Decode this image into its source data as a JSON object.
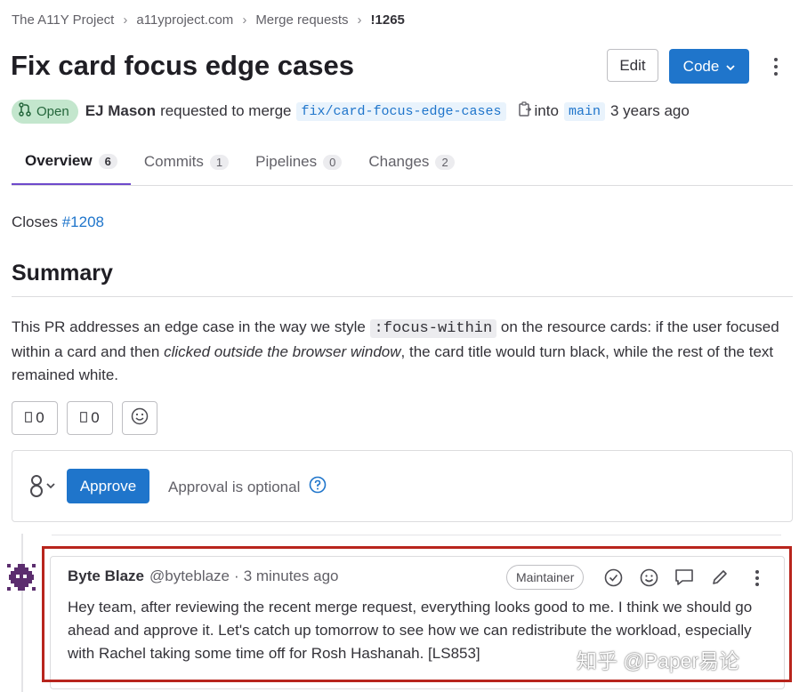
{
  "breadcrumb": {
    "items": [
      "The A11Y Project",
      "a11yproject.com",
      "Merge requests"
    ],
    "current": "!1265"
  },
  "page_title": "Fix card focus edge cases",
  "header_actions": {
    "edit_label": "Edit",
    "code_label": "Code"
  },
  "meta": {
    "status": "Open",
    "author": "EJ Mason",
    "action_text": "requested to merge",
    "source_branch": "fix/card-focus-edge-cases",
    "into_text": "into",
    "target_branch": "main",
    "time": "3 years ago"
  },
  "tabs": [
    {
      "label": "Overview",
      "count": "6"
    },
    {
      "label": "Commits",
      "count": "1"
    },
    {
      "label": "Pipelines",
      "count": "0"
    },
    {
      "label": "Changes",
      "count": "2"
    }
  ],
  "description": {
    "closes_label": "Closes",
    "closes_issue": "#1208",
    "summary_heading": "Summary",
    "para_part1": "This PR addresses an edge case in the way we style ",
    "para_code": ":focus-within",
    "para_part2": " on the resource cards: if the user focused within a card and then ",
    "para_emph": "clicked outside the browser window",
    "para_part3": ", the card title would turn black, while the rest of the text remained white."
  },
  "reactions": {
    "thumbs_up_count": "0",
    "thumbs_down_count": "0"
  },
  "approval": {
    "approve_label": "Approve",
    "status_text": "Approval is optional"
  },
  "comment": {
    "author": "Byte Blaze",
    "username": "@byteblaze",
    "separator": "·",
    "time": "3 minutes ago",
    "role": "Maintainer",
    "body": "Hey team, after reviewing the recent merge request, everything looks good to me. I think we should go ahead and approve it. Let's catch up tomorrow to see how we can redistribute the workload, especially with Rachel taking some time off for Rosh Hashanah. [LS853]"
  },
  "watermark": "知乎 @Paper易论",
  "colors": {
    "accent_blue": "#1f75cb",
    "tab_underline": "#6e49cb",
    "open_badge_bg": "#c3e6cd",
    "highlight_border": "#b8251d"
  },
  "icons": [
    "merge-request-icon",
    "copy-icon",
    "chevron-down-icon",
    "kebab-icon",
    "thumbs-up-icon",
    "thumbs-down-icon",
    "smiley-icon",
    "approvers-icon",
    "help-icon",
    "resolve-icon",
    "reply-icon",
    "edit-icon",
    "avatar-icon"
  ]
}
